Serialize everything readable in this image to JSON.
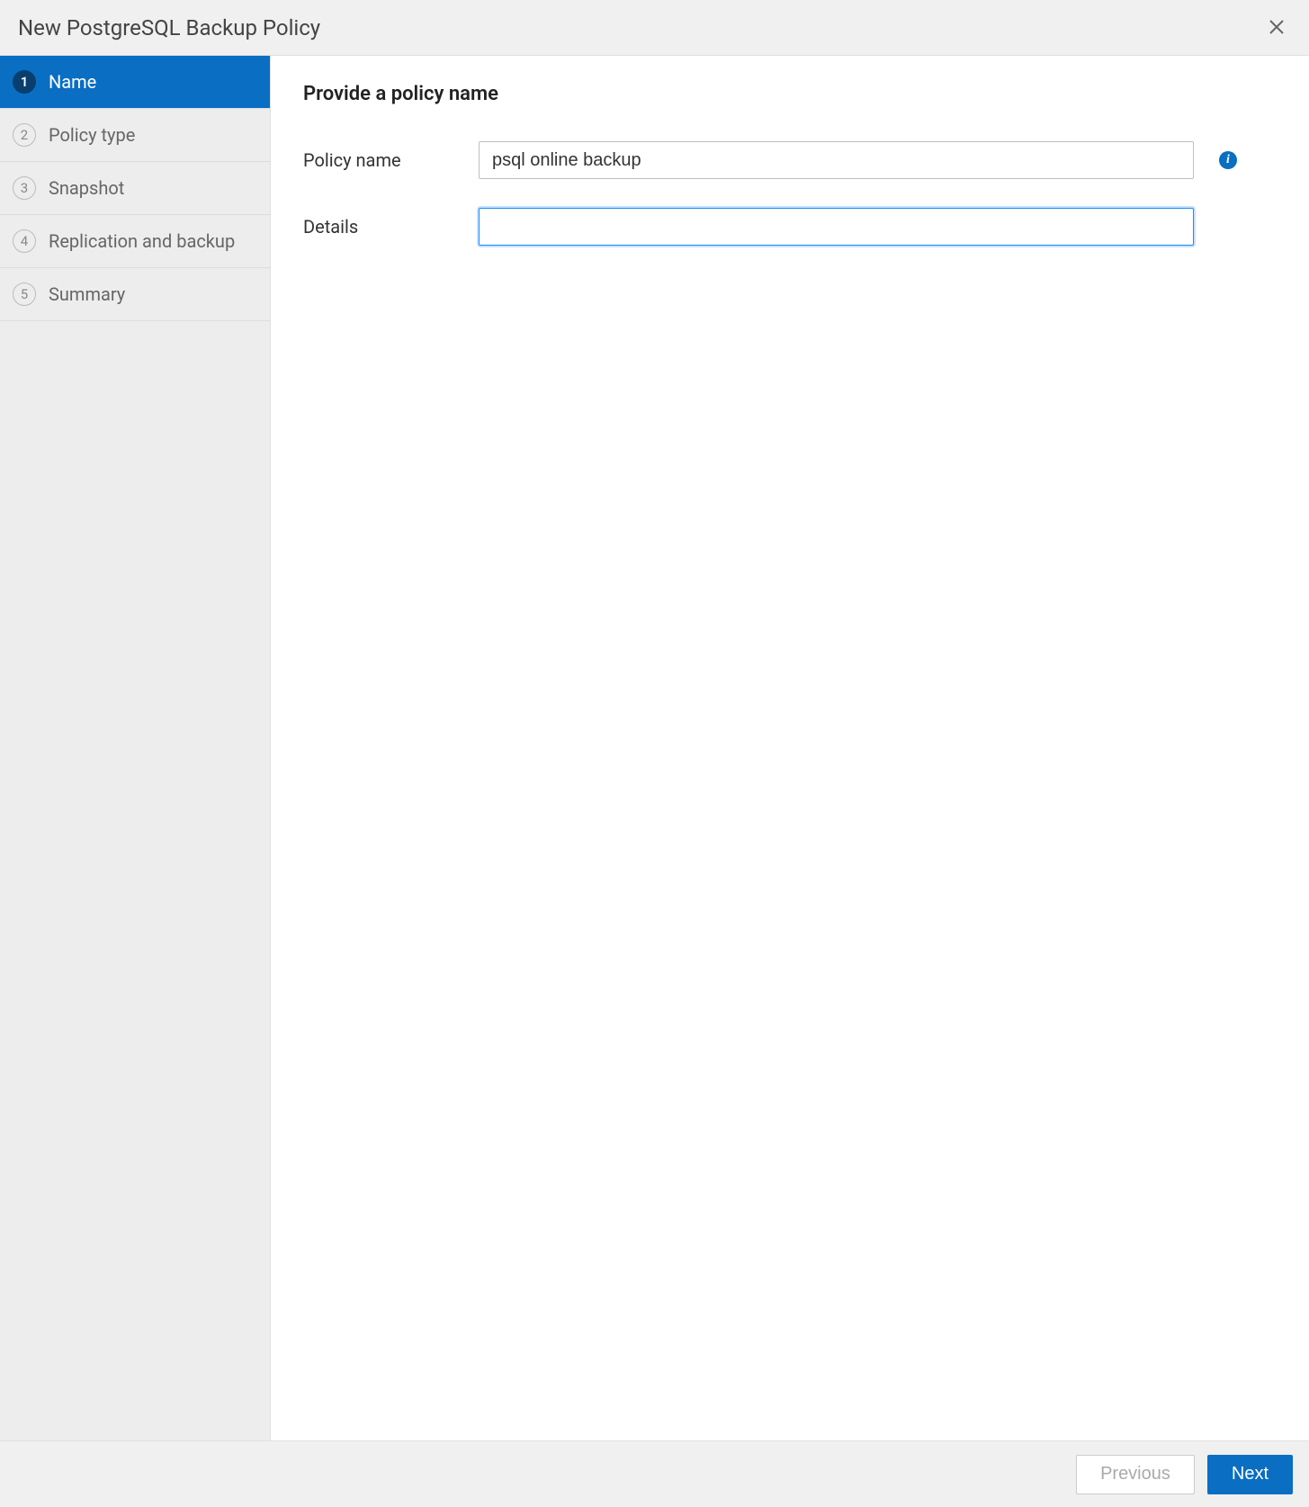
{
  "header": {
    "title": "New PostgreSQL Backup Policy"
  },
  "sidebar": {
    "steps": [
      {
        "num": "1",
        "label": "Name",
        "active": true
      },
      {
        "num": "2",
        "label": "Policy type",
        "active": false
      },
      {
        "num": "3",
        "label": "Snapshot",
        "active": false
      },
      {
        "num": "4",
        "label": "Replication and backup",
        "active": false
      },
      {
        "num": "5",
        "label": "Summary",
        "active": false
      }
    ]
  },
  "main": {
    "heading": "Provide a policy name",
    "policy_name_label": "Policy name",
    "policy_name_value": "psql online backup",
    "details_label": "Details",
    "details_value": ""
  },
  "footer": {
    "previous_label": "Previous",
    "next_label": "Next"
  }
}
